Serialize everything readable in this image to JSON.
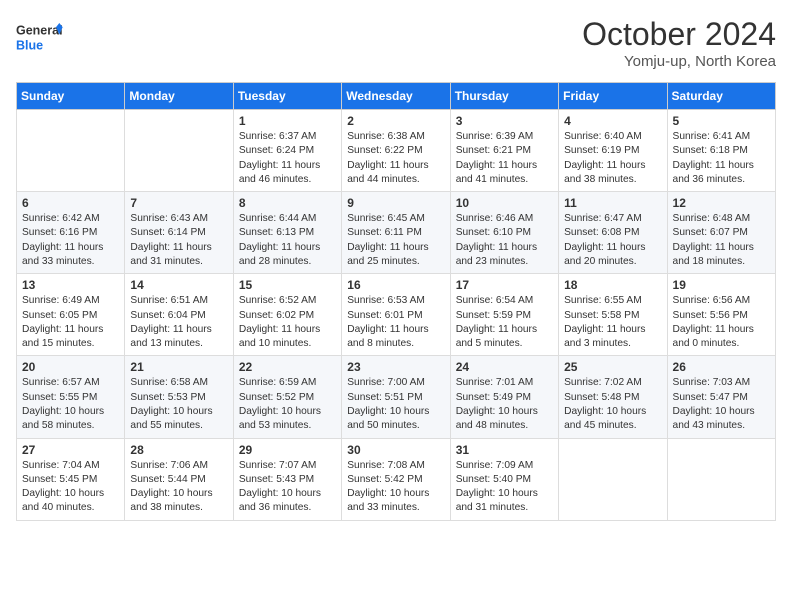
{
  "logo": {
    "line1": "General",
    "line2": "Blue"
  },
  "title": "October 2024",
  "location": "Yomju-up, North Korea",
  "weekdays": [
    "Sunday",
    "Monday",
    "Tuesday",
    "Wednesday",
    "Thursday",
    "Friday",
    "Saturday"
  ],
  "weeks": [
    [
      {
        "day": "",
        "text": ""
      },
      {
        "day": "",
        "text": ""
      },
      {
        "day": "1",
        "text": "Sunrise: 6:37 AM\nSunset: 6:24 PM\nDaylight: 11 hours and 46 minutes."
      },
      {
        "day": "2",
        "text": "Sunrise: 6:38 AM\nSunset: 6:22 PM\nDaylight: 11 hours and 44 minutes."
      },
      {
        "day": "3",
        "text": "Sunrise: 6:39 AM\nSunset: 6:21 PM\nDaylight: 11 hours and 41 minutes."
      },
      {
        "day": "4",
        "text": "Sunrise: 6:40 AM\nSunset: 6:19 PM\nDaylight: 11 hours and 38 minutes."
      },
      {
        "day": "5",
        "text": "Sunrise: 6:41 AM\nSunset: 6:18 PM\nDaylight: 11 hours and 36 minutes."
      }
    ],
    [
      {
        "day": "6",
        "text": "Sunrise: 6:42 AM\nSunset: 6:16 PM\nDaylight: 11 hours and 33 minutes."
      },
      {
        "day": "7",
        "text": "Sunrise: 6:43 AM\nSunset: 6:14 PM\nDaylight: 11 hours and 31 minutes."
      },
      {
        "day": "8",
        "text": "Sunrise: 6:44 AM\nSunset: 6:13 PM\nDaylight: 11 hours and 28 minutes."
      },
      {
        "day": "9",
        "text": "Sunrise: 6:45 AM\nSunset: 6:11 PM\nDaylight: 11 hours and 25 minutes."
      },
      {
        "day": "10",
        "text": "Sunrise: 6:46 AM\nSunset: 6:10 PM\nDaylight: 11 hours and 23 minutes."
      },
      {
        "day": "11",
        "text": "Sunrise: 6:47 AM\nSunset: 6:08 PM\nDaylight: 11 hours and 20 minutes."
      },
      {
        "day": "12",
        "text": "Sunrise: 6:48 AM\nSunset: 6:07 PM\nDaylight: 11 hours and 18 minutes."
      }
    ],
    [
      {
        "day": "13",
        "text": "Sunrise: 6:49 AM\nSunset: 6:05 PM\nDaylight: 11 hours and 15 minutes."
      },
      {
        "day": "14",
        "text": "Sunrise: 6:51 AM\nSunset: 6:04 PM\nDaylight: 11 hours and 13 minutes."
      },
      {
        "day": "15",
        "text": "Sunrise: 6:52 AM\nSunset: 6:02 PM\nDaylight: 11 hours and 10 minutes."
      },
      {
        "day": "16",
        "text": "Sunrise: 6:53 AM\nSunset: 6:01 PM\nDaylight: 11 hours and 8 minutes."
      },
      {
        "day": "17",
        "text": "Sunrise: 6:54 AM\nSunset: 5:59 PM\nDaylight: 11 hours and 5 minutes."
      },
      {
        "day": "18",
        "text": "Sunrise: 6:55 AM\nSunset: 5:58 PM\nDaylight: 11 hours and 3 minutes."
      },
      {
        "day": "19",
        "text": "Sunrise: 6:56 AM\nSunset: 5:56 PM\nDaylight: 11 hours and 0 minutes."
      }
    ],
    [
      {
        "day": "20",
        "text": "Sunrise: 6:57 AM\nSunset: 5:55 PM\nDaylight: 10 hours and 58 minutes."
      },
      {
        "day": "21",
        "text": "Sunrise: 6:58 AM\nSunset: 5:53 PM\nDaylight: 10 hours and 55 minutes."
      },
      {
        "day": "22",
        "text": "Sunrise: 6:59 AM\nSunset: 5:52 PM\nDaylight: 10 hours and 53 minutes."
      },
      {
        "day": "23",
        "text": "Sunrise: 7:00 AM\nSunset: 5:51 PM\nDaylight: 10 hours and 50 minutes."
      },
      {
        "day": "24",
        "text": "Sunrise: 7:01 AM\nSunset: 5:49 PM\nDaylight: 10 hours and 48 minutes."
      },
      {
        "day": "25",
        "text": "Sunrise: 7:02 AM\nSunset: 5:48 PM\nDaylight: 10 hours and 45 minutes."
      },
      {
        "day": "26",
        "text": "Sunrise: 7:03 AM\nSunset: 5:47 PM\nDaylight: 10 hours and 43 minutes."
      }
    ],
    [
      {
        "day": "27",
        "text": "Sunrise: 7:04 AM\nSunset: 5:45 PM\nDaylight: 10 hours and 40 minutes."
      },
      {
        "day": "28",
        "text": "Sunrise: 7:06 AM\nSunset: 5:44 PM\nDaylight: 10 hours and 38 minutes."
      },
      {
        "day": "29",
        "text": "Sunrise: 7:07 AM\nSunset: 5:43 PM\nDaylight: 10 hours and 36 minutes."
      },
      {
        "day": "30",
        "text": "Sunrise: 7:08 AM\nSunset: 5:42 PM\nDaylight: 10 hours and 33 minutes."
      },
      {
        "day": "31",
        "text": "Sunrise: 7:09 AM\nSunset: 5:40 PM\nDaylight: 10 hours and 31 minutes."
      },
      {
        "day": "",
        "text": ""
      },
      {
        "day": "",
        "text": ""
      }
    ]
  ]
}
